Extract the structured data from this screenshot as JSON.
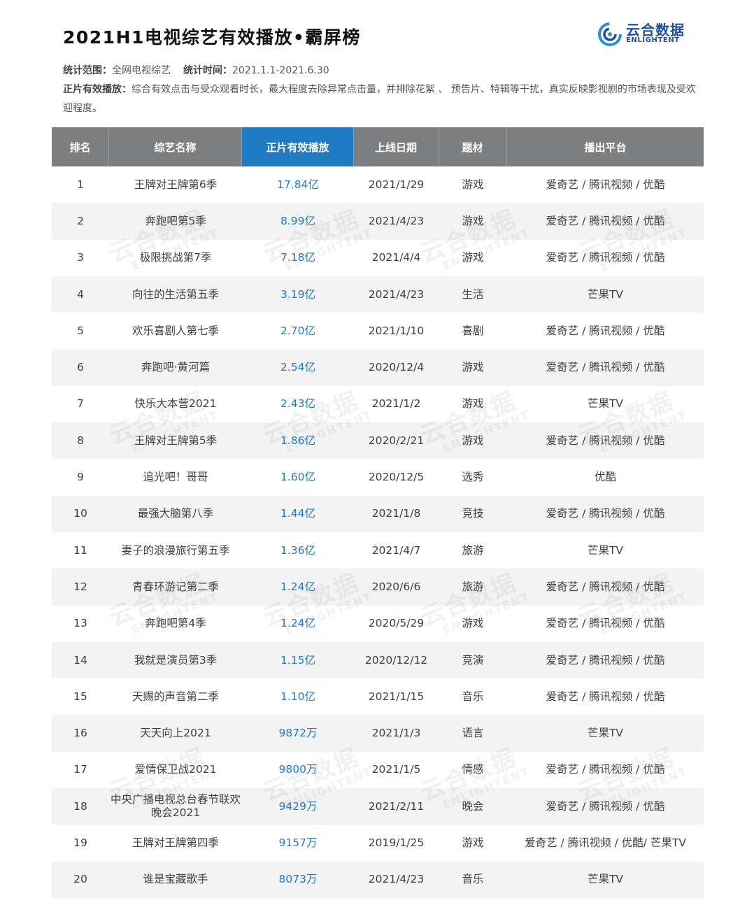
{
  "title": "2021H1电视综艺有效播放•霸屏榜",
  "logo": {
    "cn": "云合数据",
    "en": "ENLIGHTENT",
    "color": "#1d4e9e"
  },
  "meta": {
    "scope_label": "统计范围：",
    "scope_value": "全网电视综艺",
    "time_label": "统计时间：",
    "time_value": "2021.1.1-2021.6.30",
    "def_label": "正片有效播放：",
    "def_value": "综合有效点击与受众观看时长，最大程度去除异常点击量，并排除花絮 、 预告片、特辑等干扰，真实反映影视剧的市场表现及受欢迎程度。"
  },
  "table": {
    "headers": [
      "排名",
      "综艺名称",
      "正片有效播放",
      "上线日期",
      "题材",
      "播出平台"
    ],
    "rows": [
      [
        "1",
        "王牌对王牌第6季",
        "17.84亿",
        "2021/1/29",
        "游戏",
        "爱奇艺 / 腾讯视频 / 优酷"
      ],
      [
        "2",
        "奔跑吧第5季",
        "8.99亿",
        "2021/4/23",
        "游戏",
        "爱奇艺 / 腾讯视频 / 优酷"
      ],
      [
        "3",
        "极限挑战第7季",
        "7.18亿",
        "2021/4/4",
        "游戏",
        "爱奇艺 / 腾讯视频 / 优酷"
      ],
      [
        "4",
        "向往的生活第五季",
        "3.19亿",
        "2021/4/23",
        "生活",
        "芒果TV"
      ],
      [
        "5",
        "欢乐喜剧人第七季",
        "2.70亿",
        "2021/1/10",
        "喜剧",
        "爱奇艺 / 腾讯视频 / 优酷"
      ],
      [
        "6",
        "奔跑吧·黄河篇",
        "2.54亿",
        "2020/12/4",
        "游戏",
        "爱奇艺 / 腾讯视频 / 优酷"
      ],
      [
        "7",
        "快乐大本营2021",
        "2.43亿",
        "2021/1/2",
        "游戏",
        "芒果TV"
      ],
      [
        "8",
        "王牌对王牌第5季",
        "1.86亿",
        "2020/2/21",
        "游戏",
        "爱奇艺 / 腾讯视频 / 优酷"
      ],
      [
        "9",
        "追光吧！哥哥",
        "1.60亿",
        "2020/12/5",
        "选秀",
        "优酷"
      ],
      [
        "10",
        "最强大脑第八季",
        "1.44亿",
        "2021/1/8",
        "竞技",
        "爱奇艺 / 腾讯视频 / 优酷"
      ],
      [
        "11",
        "妻子的浪漫旅行第五季",
        "1.36亿",
        "2021/4/7",
        "旅游",
        "芒果TV"
      ],
      [
        "12",
        "青春环游记第二季",
        "1.24亿",
        "2020/6/6",
        "旅游",
        "爱奇艺 / 腾讯视频 / 优酷"
      ],
      [
        "13",
        "奔跑吧第4季",
        "1.24亿",
        "2020/5/29",
        "游戏",
        "爱奇艺 / 腾讯视频 / 优酷"
      ],
      [
        "14",
        "我就是演员第3季",
        "1.15亿",
        "2020/12/12",
        "竞演",
        "爱奇艺 / 腾讯视频 / 优酷"
      ],
      [
        "15",
        "天赐的声音第二季",
        "1.10亿",
        "2021/1/15",
        "音乐",
        "爱奇艺 / 腾讯视频 / 优酷"
      ],
      [
        "16",
        "天天向上2021",
        "9872万",
        "2021/1/3",
        "语言",
        "芒果TV"
      ],
      [
        "17",
        "爱情保卫战2021",
        "9800万",
        "2021/1/5",
        "情感",
        "爱奇艺 / 腾讯视频 / 优酷"
      ],
      [
        "18",
        "中央广播电视总台春节联欢晚会2021",
        "9429万",
        "2021/2/11",
        "晚会",
        "爱奇艺 / 腾讯视频 / 优酷"
      ],
      [
        "19",
        "王牌对王牌第四季",
        "9157万",
        "2019/1/25",
        "游戏",
        "爱奇艺 / 腾讯视频 / 优酷/ 芒果TV"
      ],
      [
        "20",
        "谁是宝藏歌手",
        "8073万",
        "2021/4/23",
        "音乐",
        "芒果TV"
      ]
    ]
  },
  "watermark": {
    "cn": "云合数据",
    "en": "ENLIGHTENT"
  },
  "colors": {
    "header_bg": "#7d7e80",
    "highlight": "#1f7bc4",
    "zebra": "#f3f3f3"
  }
}
